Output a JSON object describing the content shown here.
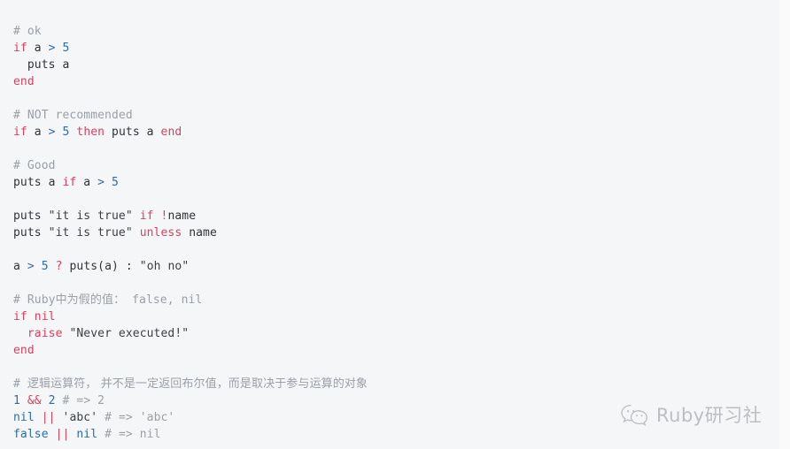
{
  "page": {
    "background_color": "#f5f6f8",
    "language": "ruby",
    "title": "Ruby conditional expressions and logical operators snippet"
  },
  "theme": {
    "comment_color": "#9aa0a6",
    "keyword_color": "#d9415f",
    "number_color": "#2d6ca2",
    "literal_color": "#2d6ca2",
    "string_color": "#3b4044",
    "plain_color": "#2f3337",
    "operator_color": "#2d6ca2"
  },
  "code": {
    "lines": [
      {
        "id": "l01",
        "tokens": [
          {
            "t": "# ok",
            "c": "comment"
          }
        ]
      },
      {
        "id": "l02",
        "tokens": [
          {
            "t": "if",
            "c": "keyword"
          },
          {
            "t": " a ",
            "c": "plain"
          },
          {
            "t": ">",
            "c": "op"
          },
          {
            "t": " ",
            "c": "plain"
          },
          {
            "t": "5",
            "c": "number"
          }
        ]
      },
      {
        "id": "l03",
        "tokens": [
          {
            "t": "  puts a",
            "c": "plain"
          }
        ]
      },
      {
        "id": "l04",
        "tokens": [
          {
            "t": "end",
            "c": "keyword"
          }
        ]
      },
      {
        "id": "l05",
        "tokens": []
      },
      {
        "id": "l06",
        "tokens": [
          {
            "t": "# NOT recommended",
            "c": "comment"
          }
        ]
      },
      {
        "id": "l07",
        "tokens": [
          {
            "t": "if",
            "c": "keyword"
          },
          {
            "t": " a ",
            "c": "plain"
          },
          {
            "t": ">",
            "c": "op"
          },
          {
            "t": " ",
            "c": "plain"
          },
          {
            "t": "5",
            "c": "number"
          },
          {
            "t": " ",
            "c": "plain"
          },
          {
            "t": "then",
            "c": "keyword"
          },
          {
            "t": " puts a ",
            "c": "plain"
          },
          {
            "t": "end",
            "c": "keyword"
          }
        ]
      },
      {
        "id": "l08",
        "tokens": []
      },
      {
        "id": "l09",
        "tokens": [
          {
            "t": "# Good",
            "c": "comment"
          }
        ]
      },
      {
        "id": "l10",
        "tokens": [
          {
            "t": "puts a ",
            "c": "plain"
          },
          {
            "t": "if",
            "c": "keyword"
          },
          {
            "t": " a ",
            "c": "plain"
          },
          {
            "t": ">",
            "c": "op"
          },
          {
            "t": " ",
            "c": "plain"
          },
          {
            "t": "5",
            "c": "number"
          }
        ]
      },
      {
        "id": "l11",
        "tokens": []
      },
      {
        "id": "l12",
        "tokens": [
          {
            "t": "puts ",
            "c": "plain"
          },
          {
            "t": "\"it is true\"",
            "c": "string"
          },
          {
            "t": " ",
            "c": "plain"
          },
          {
            "t": "if",
            "c": "keyword"
          },
          {
            "t": " ",
            "c": "plain"
          },
          {
            "t": "!",
            "c": "opred"
          },
          {
            "t": "name",
            "c": "plain"
          }
        ]
      },
      {
        "id": "l13",
        "tokens": [
          {
            "t": "puts ",
            "c": "plain"
          },
          {
            "t": "\"it is true\"",
            "c": "string"
          },
          {
            "t": " ",
            "c": "plain"
          },
          {
            "t": "unless",
            "c": "keyword"
          },
          {
            "t": " name",
            "c": "plain"
          }
        ]
      },
      {
        "id": "l14",
        "tokens": []
      },
      {
        "id": "l15",
        "tokens": [
          {
            "t": "a ",
            "c": "plain"
          },
          {
            "t": ">",
            "c": "op"
          },
          {
            "t": " ",
            "c": "plain"
          },
          {
            "t": "5",
            "c": "number"
          },
          {
            "t": " ",
            "c": "plain"
          },
          {
            "t": "?",
            "c": "opred"
          },
          {
            "t": " puts(a) ",
            "c": "plain"
          },
          {
            "t": ":",
            "c": "plain"
          },
          {
            "t": " ",
            "c": "plain"
          },
          {
            "t": "\"oh no\"",
            "c": "string"
          }
        ]
      },
      {
        "id": "l16",
        "tokens": []
      },
      {
        "id": "l17",
        "tokens": [
          {
            "t": "# Ruby",
            "c": "comment"
          },
          {
            "t": "中为假的值：",
            "c": "comment-cjk"
          },
          {
            "t": " false, nil",
            "c": "comment"
          }
        ]
      },
      {
        "id": "l18",
        "tokens": [
          {
            "t": "if",
            "c": "keyword"
          },
          {
            "t": " ",
            "c": "plain"
          },
          {
            "t": "nil",
            "c": "keyword"
          }
        ]
      },
      {
        "id": "l19",
        "tokens": [
          {
            "t": "  ",
            "c": "plain"
          },
          {
            "t": "raise",
            "c": "keyword"
          },
          {
            "t": " ",
            "c": "plain"
          },
          {
            "t": "\"Never executed!\"",
            "c": "string"
          }
        ]
      },
      {
        "id": "l20",
        "tokens": [
          {
            "t": "end",
            "c": "keyword"
          }
        ]
      },
      {
        "id": "l21",
        "tokens": []
      },
      {
        "id": "l22",
        "tokens": [
          {
            "t": "# ",
            "c": "comment"
          },
          {
            "t": "逻辑运算符， 并不是一定返回布尔值，而是取决于参与运算的对象",
            "c": "comment-cjk"
          }
        ]
      },
      {
        "id": "l23",
        "tokens": [
          {
            "t": "1",
            "c": "number"
          },
          {
            "t": " ",
            "c": "plain"
          },
          {
            "t": "&&",
            "c": "opred"
          },
          {
            "t": " ",
            "c": "plain"
          },
          {
            "t": "2",
            "c": "number"
          },
          {
            "t": " ",
            "c": "plain"
          },
          {
            "t": "# => 2",
            "c": "comment"
          }
        ]
      },
      {
        "id": "l24",
        "tokens": [
          {
            "t": "nil",
            "c": "literal"
          },
          {
            "t": " ",
            "c": "plain"
          },
          {
            "t": "||",
            "c": "opred"
          },
          {
            "t": " ",
            "c": "plain"
          },
          {
            "t": "'abc'",
            "c": "string"
          },
          {
            "t": " ",
            "c": "plain"
          },
          {
            "t": "# => 'abc'",
            "c": "comment"
          }
        ]
      },
      {
        "id": "l25",
        "tokens": [
          {
            "t": "false",
            "c": "literal"
          },
          {
            "t": " ",
            "c": "plain"
          },
          {
            "t": "||",
            "c": "opred"
          },
          {
            "t": " ",
            "c": "plain"
          },
          {
            "t": "nil",
            "c": "literal"
          },
          {
            "t": " ",
            "c": "plain"
          },
          {
            "t": "# => nil",
            "c": "comment"
          }
        ]
      }
    ]
  },
  "watermark": {
    "icon": "wechat-icon",
    "text": "Ruby研习社",
    "color": "#6d7278"
  }
}
